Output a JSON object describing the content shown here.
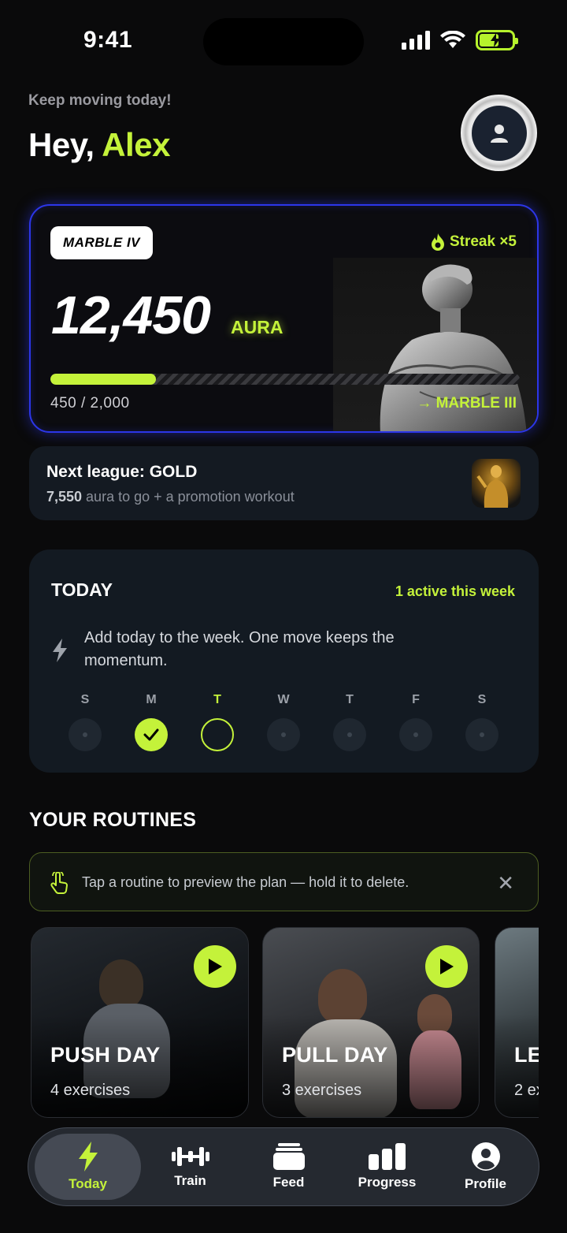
{
  "status": {
    "time": "9:41"
  },
  "header": {
    "subtitle": "Keep moving today!",
    "greeting_prefix": "Hey, ",
    "user_name": "Alex"
  },
  "aura": {
    "tier": "MARBLE IV",
    "streak": "Streak ×5",
    "value": "12,450",
    "unit": "AURA",
    "progress_label": "450 / 2,000",
    "progress_fraction": 0.225,
    "next_tier": "→ MARBLE III"
  },
  "league": {
    "title": "Next league: GOLD",
    "aura_to_go": "7,550",
    "sub_rest": " aura to go + a promotion workout"
  },
  "today": {
    "title": "TODAY",
    "active": "1 active this week",
    "message": "Add today to the week. One move keeps the momentum.",
    "days": [
      {
        "letter": "S",
        "state": "empty"
      },
      {
        "letter": "M",
        "state": "done"
      },
      {
        "letter": "T",
        "state": "current"
      },
      {
        "letter": "W",
        "state": "empty"
      },
      {
        "letter": "T",
        "state": "empty"
      },
      {
        "letter": "F",
        "state": "empty"
      },
      {
        "letter": "S",
        "state": "empty"
      }
    ]
  },
  "routines": {
    "heading": "YOUR ROUTINES",
    "tip": "Tap a routine to preview the plan — hold it to delete.",
    "items": [
      {
        "name": "PUSH DAY",
        "count": "4 exercises"
      },
      {
        "name": "PULL DAY",
        "count": "3 exercises"
      },
      {
        "name": "LE",
        "count": "2 ex"
      }
    ]
  },
  "tabs": [
    {
      "label": "Today",
      "icon": "bolt-icon"
    },
    {
      "label": "Train",
      "icon": "dumbbell-icon"
    },
    {
      "label": "Feed",
      "icon": "feed-stack-icon"
    },
    {
      "label": "Progress",
      "icon": "bar-chart-icon"
    },
    {
      "label": "Profile",
      "icon": "person-icon"
    }
  ],
  "colors": {
    "accent": "#c4f23a",
    "card": "#131a22",
    "glow": "#2c36e8",
    "background": "#0a0a0b"
  }
}
